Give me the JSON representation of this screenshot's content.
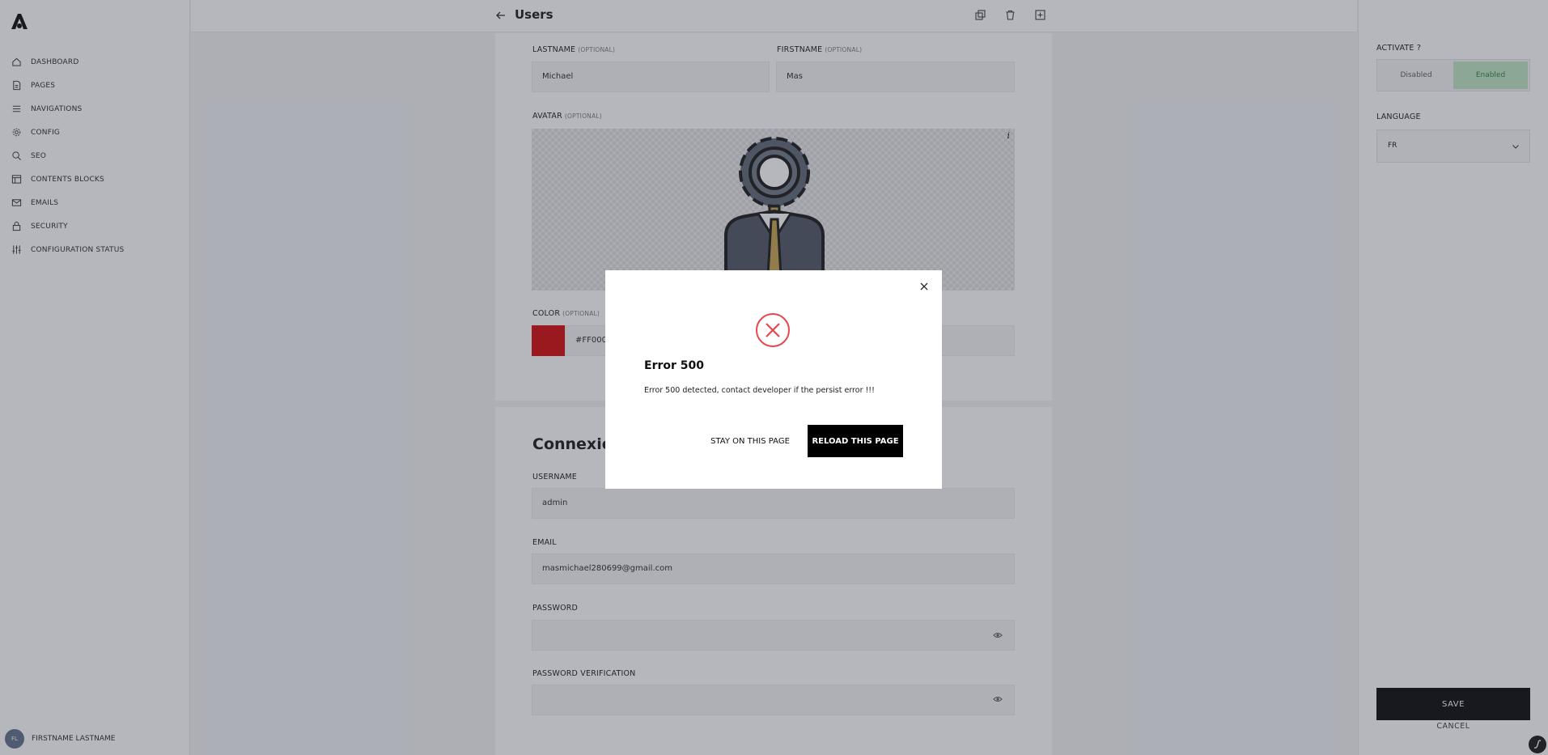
{
  "sidebar": {
    "items": [
      {
        "label": "DASHBOARD",
        "icon": "home-icon"
      },
      {
        "label": "PAGES",
        "icon": "file-icon"
      },
      {
        "label": "NAVIGATIONS",
        "icon": "menu-icon"
      },
      {
        "label": "CONFIG",
        "icon": "gear-icon"
      },
      {
        "label": "SEO",
        "icon": "search-icon"
      },
      {
        "label": "CONTENTS BLOCKS",
        "icon": "layout-icon"
      },
      {
        "label": "EMAILS",
        "icon": "mail-icon"
      },
      {
        "label": "SECURITY",
        "icon": "lock-icon"
      },
      {
        "label": "CONFIGURATION STATUS",
        "icon": "sliders-icon"
      }
    ],
    "user": {
      "initials": "FL",
      "name": "FIRSTNAME LASTNAME"
    }
  },
  "header": {
    "title": "Users",
    "icons": [
      "back-arrow-icon",
      "duplicate-icon",
      "trash-icon",
      "add-icon"
    ]
  },
  "form": {
    "lastname": {
      "label": "LASTNAME",
      "optional": "(OPTIONAL)",
      "value": "Michael"
    },
    "firstname": {
      "label": "FIRSTNAME",
      "optional": "(OPTIONAL)",
      "value": "Mas"
    },
    "avatar": {
      "label": "AVATAR",
      "optional": "(OPTIONAL)",
      "info": "i"
    },
    "color": {
      "label": "COLOR",
      "optional": "(OPTIONAL)",
      "value": "#FF000"
    },
    "connexion": {
      "title": "Connexion",
      "username": {
        "label": "USERNAME",
        "value": "admin"
      },
      "email": {
        "label": "EMAIL",
        "value": "masmichael280699@gmail.com"
      },
      "password": {
        "label": "PASSWORD",
        "value": ""
      },
      "password_verification": {
        "label": "PASSWORD VERIFICATION",
        "value": ""
      }
    }
  },
  "right_panel": {
    "activate": {
      "label": "ACTIVATE ?",
      "options": [
        "Disabled",
        "Enabled"
      ],
      "selected": "Enabled"
    },
    "language": {
      "label": "LANGUAGE",
      "value": "FR"
    },
    "save_label": "SAVE",
    "cancel_label": "CANCEL"
  },
  "modal": {
    "title": "Error 500",
    "message": "Error 500 detected, contact developer if the persist error !!!",
    "stay_label": "STAY ON THIS PAGE",
    "reload_label": "RELOAD THIS PAGE"
  },
  "colors": {
    "accent": "#000000",
    "error": "#e5484d",
    "enabled_bg": "#bfe5c3",
    "swatch": "#d30000"
  }
}
